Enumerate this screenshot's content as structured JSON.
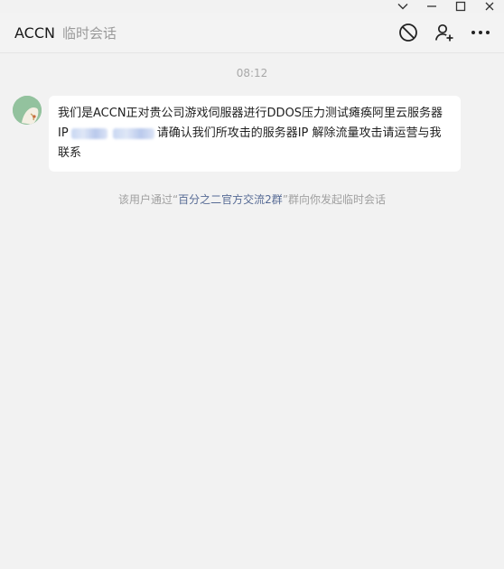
{
  "window": {
    "controls": [
      "chevron-down",
      "minimize",
      "maximize",
      "close"
    ]
  },
  "header": {
    "chat_name": "ACCN",
    "chat_subtitle": "临时会话",
    "icons": [
      "block-icon",
      "add-contact-icon",
      "more-icon"
    ]
  },
  "chat": {
    "timestamp": "08:12",
    "message": {
      "part1": "我们是ACCN正对贵公司游戏伺服器进行DDOS压力测试瘫痪阿里云服务器IP",
      "part2": "请确认我们所攻击的服务器IP 解除流量攻击请运营与我联系"
    },
    "system_note": {
      "prefix": "该用户通过“",
      "group_name": "百分之二官方交流2群",
      "suffix": "”群向你发起临时会话"
    }
  },
  "colors": {
    "background": "#f2f2f2",
    "bubble": "#ffffff",
    "link": "#576b95",
    "muted_text": "#a0a0a0"
  }
}
